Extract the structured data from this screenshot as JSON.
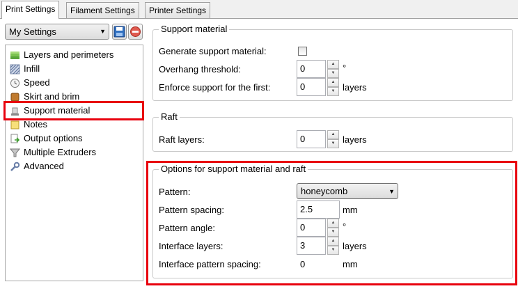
{
  "tabs": [
    {
      "label": "Print Settings",
      "active": true
    },
    {
      "label": "Filament Settings",
      "active": false
    },
    {
      "label": "Printer Settings",
      "active": false
    }
  ],
  "preset": {
    "value": "My Settings"
  },
  "icons": {
    "save": "save-disk-icon",
    "delete": "delete-red-icon"
  },
  "tree": {
    "items": [
      {
        "label": "Layers and perimeters",
        "icon": "layers-icon"
      },
      {
        "label": "Infill",
        "icon": "infill-icon"
      },
      {
        "label": "Speed",
        "icon": "clock-icon"
      },
      {
        "label": "Skirt and brim",
        "icon": "brim-icon"
      },
      {
        "label": "Support material",
        "icon": "support-icon",
        "selected": true
      },
      {
        "label": "Notes",
        "icon": "note-icon"
      },
      {
        "label": "Output options",
        "icon": "output-icon"
      },
      {
        "label": "Multiple Extruders",
        "icon": "funnel-icon"
      },
      {
        "label": "Advanced",
        "icon": "wrench-icon"
      }
    ]
  },
  "support_material": {
    "title": "Support material",
    "generate_label": "Generate support material:",
    "generate_checked": false,
    "overhang_label": "Overhang threshold:",
    "overhang_value": "0",
    "overhang_unit": "°",
    "enforce_label": "Enforce support for the first:",
    "enforce_value": "0",
    "enforce_unit": "layers"
  },
  "raft": {
    "title": "Raft",
    "layers_label": "Raft layers:",
    "layers_value": "0",
    "layers_unit": "layers"
  },
  "options": {
    "title": "Options for support material and raft",
    "pattern_label": "Pattern:",
    "pattern_value": "honeycomb",
    "spacing_label": "Pattern spacing:",
    "spacing_value": "2.5",
    "spacing_unit": "mm",
    "angle_label": "Pattern angle:",
    "angle_value": "0",
    "angle_unit": "°",
    "interface_layers_label": "Interface layers:",
    "interface_layers_value": "3",
    "interface_layers_unit": "layers",
    "interface_spacing_label": "Interface pattern spacing:",
    "interface_spacing_value": "0",
    "interface_spacing_unit": "mm"
  },
  "colors": {
    "highlight": "#e8000d",
    "selected_bg": "#ffffff"
  }
}
